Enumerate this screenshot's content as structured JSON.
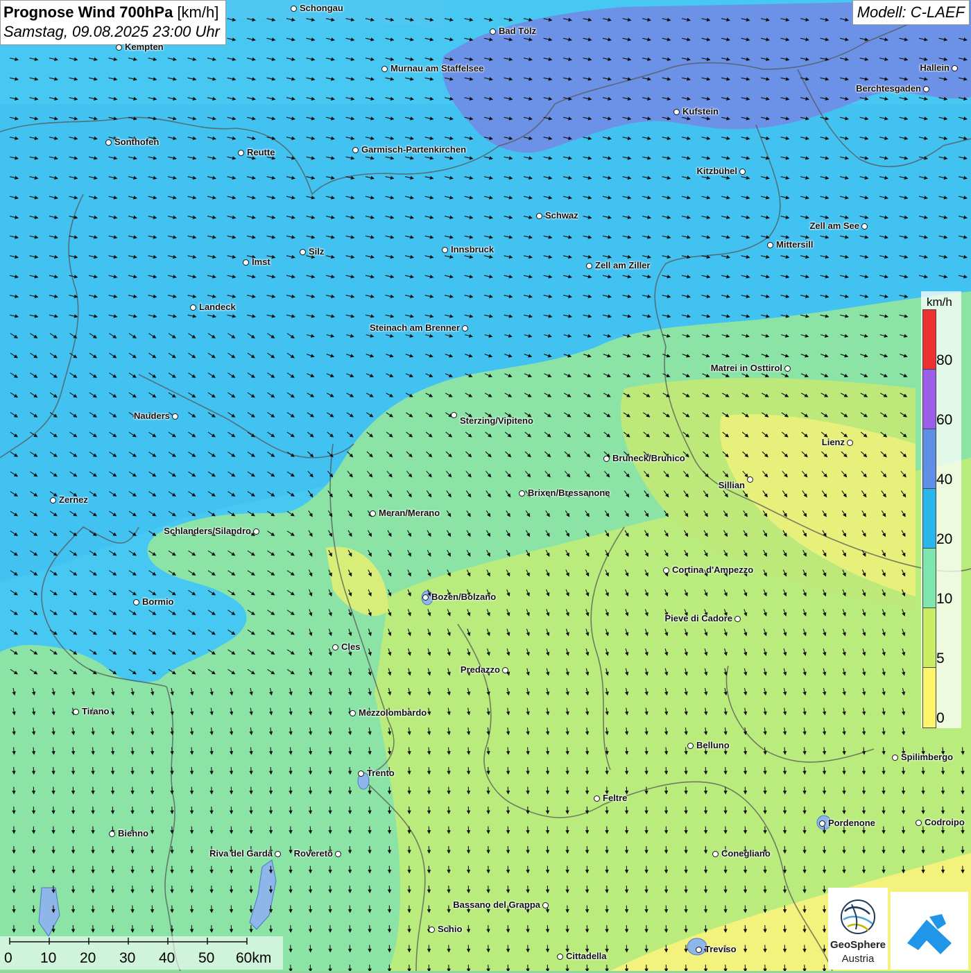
{
  "header": {
    "title": "Prognose Wind 700hPa",
    "title_unit": "[km/h]",
    "datetime": "Samstag, 09.08.2025 23:00 Uhr",
    "model": "Modell: C-LAEF"
  },
  "legend": {
    "unit": "km/h",
    "labels": [
      "80",
      "60",
      "40",
      "20",
      "10",
      "5",
      "0"
    ],
    "colors": [
      "#ee3030",
      "#9a5ee8",
      "#5f8ee6",
      "#29b6ea",
      "#7de7ae",
      "#c9ee66",
      "#fff46a"
    ]
  },
  "scalebar": {
    "ticks": [
      "0",
      "10",
      "20",
      "30",
      "40",
      "50",
      "60km"
    ]
  },
  "logos": {
    "geosphere_line1": "GeoSphere",
    "geosphere_line2": "Austria"
  },
  "cities": [
    {
      "name": "Schongau"
    },
    {
      "name": "Bad Tölz"
    },
    {
      "name": "Kempten"
    },
    {
      "name": "Murnau am Staffelsee"
    },
    {
      "name": "Hallein"
    },
    {
      "name": "Berchtesgaden"
    },
    {
      "name": "Kufstein"
    },
    {
      "name": "Sonthofen"
    },
    {
      "name": "Reutte"
    },
    {
      "name": "Garmisch-Partenkirchen"
    },
    {
      "name": "Kitzbühel"
    },
    {
      "name": "Schwaz"
    },
    {
      "name": "Zell am See"
    },
    {
      "name": "Mittersill"
    },
    {
      "name": "Innsbruck"
    },
    {
      "name": "Silz"
    },
    {
      "name": "Imst"
    },
    {
      "name": "Zell am Ziller"
    },
    {
      "name": "Landeck"
    },
    {
      "name": "Steinach am Brenner"
    },
    {
      "name": "Matrei in Osttirol"
    },
    {
      "name": "Nauders"
    },
    {
      "name": "Sterzing/Vipiteno"
    },
    {
      "name": "Lienz"
    },
    {
      "name": "Bruneck/Brunico"
    },
    {
      "name": "Sillian"
    },
    {
      "name": "Brixen/Bressanone"
    },
    {
      "name": "Zernez"
    },
    {
      "name": "Meran/Merano"
    },
    {
      "name": "Schlanders/Silandro"
    },
    {
      "name": "Cortina d'Ampezzo"
    },
    {
      "name": "Bozen/Bolzano"
    },
    {
      "name": "Bormio"
    },
    {
      "name": "Pieve di Cadore"
    },
    {
      "name": "Cles"
    },
    {
      "name": "Predazzo"
    },
    {
      "name": "Tirano"
    },
    {
      "name": "Mezzolombardo"
    },
    {
      "name": "Belluno"
    },
    {
      "name": "Spilimbergo"
    },
    {
      "name": "Trento"
    },
    {
      "name": "Feltre"
    },
    {
      "name": "Pordenone"
    },
    {
      "name": "Codroipo"
    },
    {
      "name": "Bienno"
    },
    {
      "name": "Riva del Garda"
    },
    {
      "name": "Rovereto"
    },
    {
      "name": "Conegliano"
    },
    {
      "name": "Bassano del Grappa"
    },
    {
      "name": "Schio"
    },
    {
      "name": "Treviso"
    },
    {
      "name": "Cittadella"
    }
  ]
}
